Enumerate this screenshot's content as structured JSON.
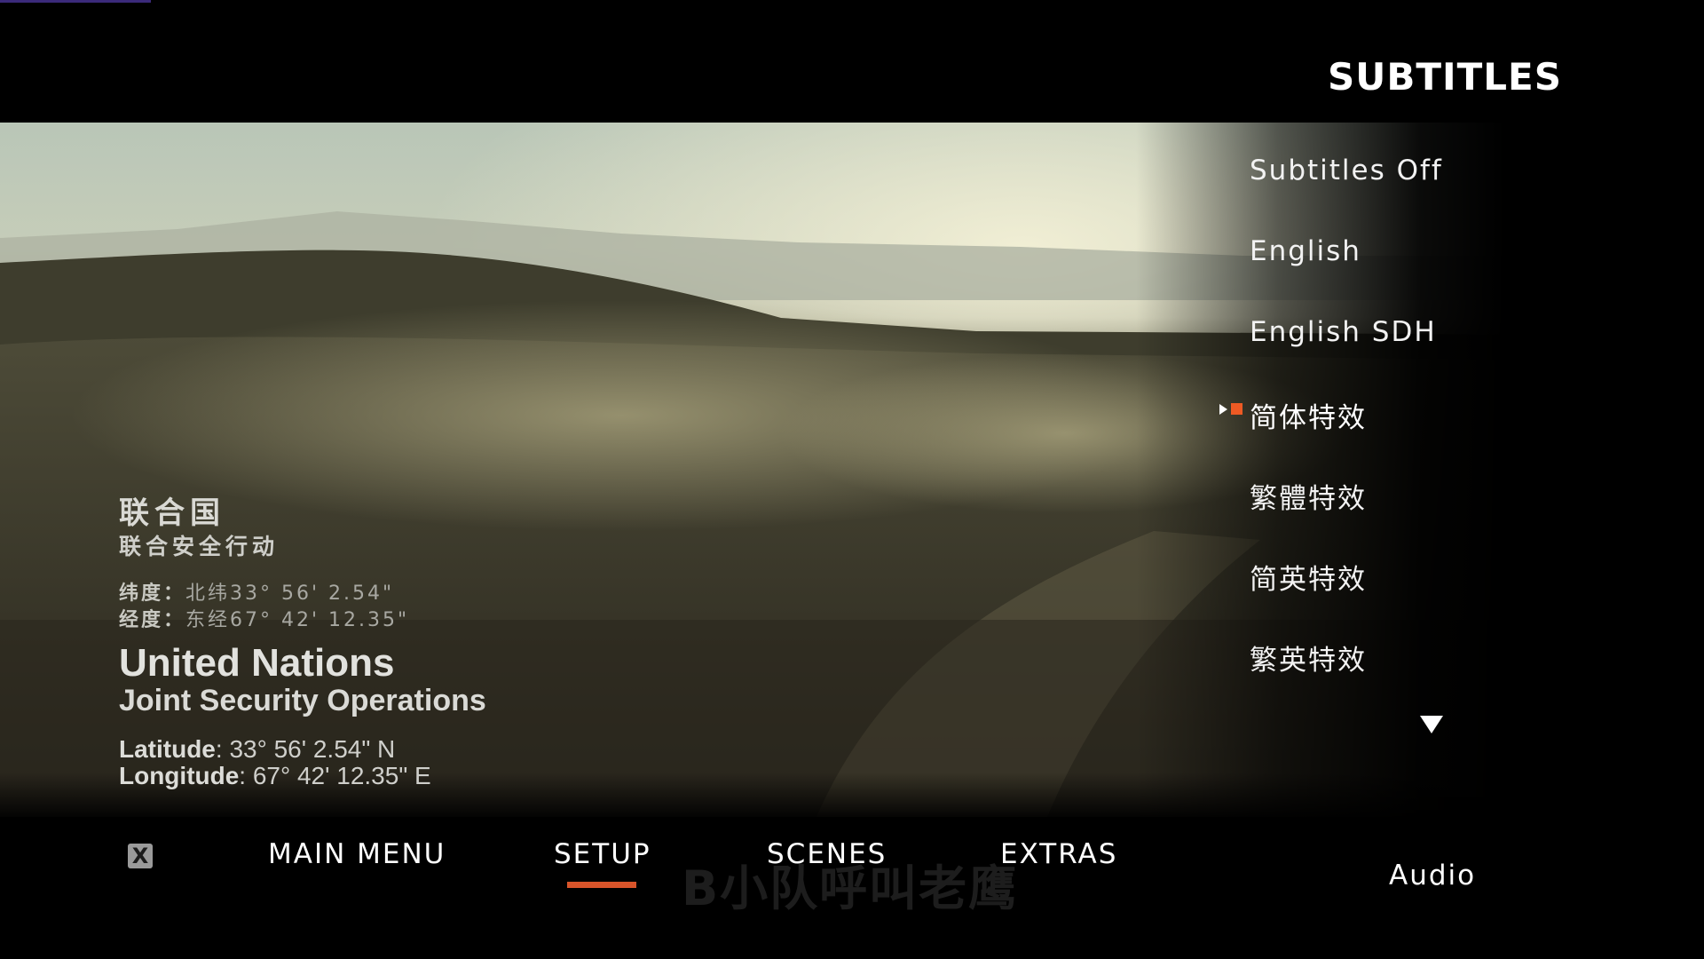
{
  "panel": {
    "title": "SUBTITLES",
    "options": [
      "Subtitles Off",
      "English",
      "English SDH",
      "简体特效",
      "繁體特效",
      "简英特效",
      "繁英特效"
    ],
    "selected_option": "简体特效"
  },
  "overlay": {
    "cn_title": "联合国",
    "cn_subtitle": "联合安全行动",
    "cn_latitude_label": "纬度：",
    "cn_latitude_value": "北纬33° 56' 2.54\"",
    "cn_longitude_label": "经度：",
    "cn_longitude_value": "东经67° 42' 12.35\"",
    "en_title": "United Nations",
    "en_subtitle": "Joint Security Operations",
    "en_latitude_label": "Latitude",
    "en_latitude_value": ": 33° 56' 2.54\" N",
    "en_longitude_label": "Longitude",
    "en_longitude_value": ": 67° 42' 12.35\" E"
  },
  "nav": {
    "close_glyph": "X",
    "main_menu": "MAIN MENU",
    "setup": "SETUP",
    "scenes": "SCENES",
    "extras": "EXTRAS",
    "active": "SETUP",
    "audio": "Audio"
  },
  "watermark": "B小队呼叫老鹰",
  "colors": {
    "accent": "#ee5a24",
    "underline": "#d8542a",
    "background": "#000000"
  },
  "icons": {
    "close": "close-icon",
    "scroll": "triangle-down-icon",
    "selection": "play-arrow-icon"
  }
}
